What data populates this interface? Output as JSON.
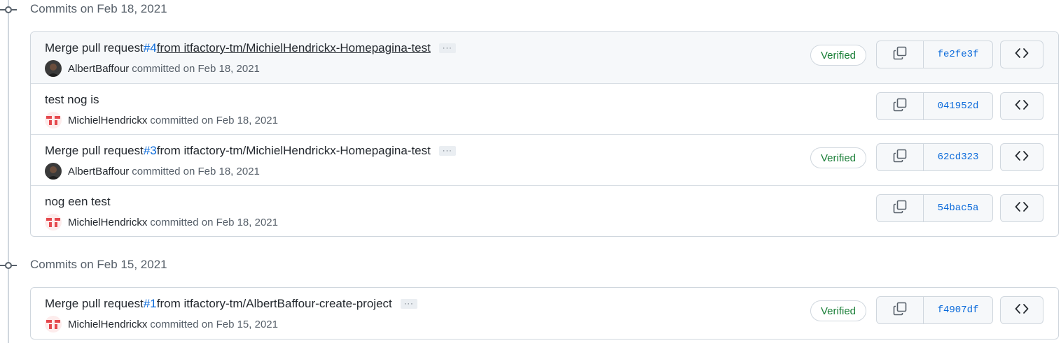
{
  "groups": [
    {
      "title": "Commits on Feb 18, 2021",
      "commits": [
        {
          "title_prefix": "Merge pull request ",
          "pr_number": "#4",
          "title_suffix": " from itfactory-tm/MichielHendrickx-Homepagina-test",
          "author": "AlbertBaffour",
          "avatar": "photo-avatar",
          "meta_text": "committed on Feb 18, 2021",
          "verified": "Verified",
          "sha": "fe2fe3f"
        },
        {
          "title_prefix": "test nog is",
          "pr_number": "",
          "title_suffix": "",
          "author": "MichielHendrickx",
          "avatar": "identicon-avatar",
          "meta_text": "committed on Feb 18, 2021",
          "verified": "",
          "sha": "041952d"
        },
        {
          "title_prefix": "Merge pull request ",
          "pr_number": "#3",
          "title_suffix": " from itfactory-tm/MichielHendrickx-Homepagina-test",
          "author": "AlbertBaffour",
          "avatar": "photo-avatar",
          "meta_text": "committed on Feb 18, 2021",
          "verified": "Verified",
          "sha": "62cd323"
        },
        {
          "title_prefix": "nog een test",
          "pr_number": "",
          "title_suffix": "",
          "author": "MichielHendrickx",
          "avatar": "identicon-avatar",
          "meta_text": "committed on Feb 18, 2021",
          "verified": "",
          "sha": "54bac5a"
        }
      ]
    },
    {
      "title": "Commits on Feb 15, 2021",
      "commits": [
        {
          "title_prefix": "Merge pull request ",
          "pr_number": "#1",
          "title_suffix": " from itfactory-tm/AlbertBaffour-create-project",
          "author": "MichielHendrickx",
          "avatar": "identicon-avatar",
          "meta_text": "committed on Feb 15, 2021",
          "verified": "Verified",
          "sha": "f4907df"
        }
      ]
    }
  ],
  "icons": {
    "commit_node": "git-commit-icon",
    "copy": "copy-icon",
    "browse": "code-icon",
    "more": "ellipsis-icon"
  },
  "colors": {
    "link": "#0969da",
    "verified": "#1a7f37",
    "muted": "#57606a",
    "border": "#d0d7de",
    "identicon": "#e5484d"
  }
}
